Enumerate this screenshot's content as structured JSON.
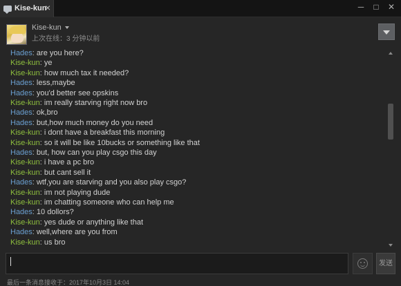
{
  "window": {
    "tab_label": "Kise-kun",
    "tab_close": "×",
    "controls": [
      "─",
      "□",
      "✕"
    ]
  },
  "header": {
    "friend_name": "Kise-kun",
    "status": "上次在线：3 分钟以前"
  },
  "colors": {
    "hades": "#6a9fd0",
    "kise": "#8fbf3e",
    "background": "#262626"
  },
  "messages": [
    {
      "speaker": "Hades",
      "text": "are you here?"
    },
    {
      "speaker": "Kise-kun",
      "text": "ye"
    },
    {
      "speaker": "Kise-kun",
      "text": "how much tax it needed?"
    },
    {
      "speaker": "Hades",
      "text": "less,maybe"
    },
    {
      "speaker": "Hades",
      "text": "you'd better see opskins"
    },
    {
      "speaker": "Kise-kun",
      "text": "im really starving right now bro"
    },
    {
      "speaker": "Hades",
      "text": "ok,bro"
    },
    {
      "speaker": "Hades",
      "text": "but,how much money do you need"
    },
    {
      "speaker": "Kise-kun",
      "text": "i dont have a breakfast this morning"
    },
    {
      "speaker": "Kise-kun",
      "text": "so it will be like 10bucks or something like that"
    },
    {
      "speaker": "Hades",
      "text": "but, how can you play csgo this day"
    },
    {
      "speaker": "Kise-kun",
      "text": "i have a pc bro"
    },
    {
      "speaker": "Kise-kun",
      "text": "but cant sell it"
    },
    {
      "speaker": "Hades",
      "text": "wtf,you are starving and you also play csgo?"
    },
    {
      "speaker": "Kise-kun",
      "text": "im not playing dude"
    },
    {
      "speaker": "Kise-kun",
      "text": "im chatting someone who can help me"
    },
    {
      "speaker": "Hades",
      "text": "10 dollors?"
    },
    {
      "speaker": "Kise-kun",
      "text": "yes dude or anything like that"
    },
    {
      "speaker": "Hades",
      "text": "well,where are you from"
    },
    {
      "speaker": "Kise-kun",
      "text": "us bro"
    }
  ],
  "composer": {
    "value": "",
    "send_label": "发送"
  },
  "footer": {
    "last_message": "最后一条消息接收于：2017年10月3日 14:04"
  }
}
